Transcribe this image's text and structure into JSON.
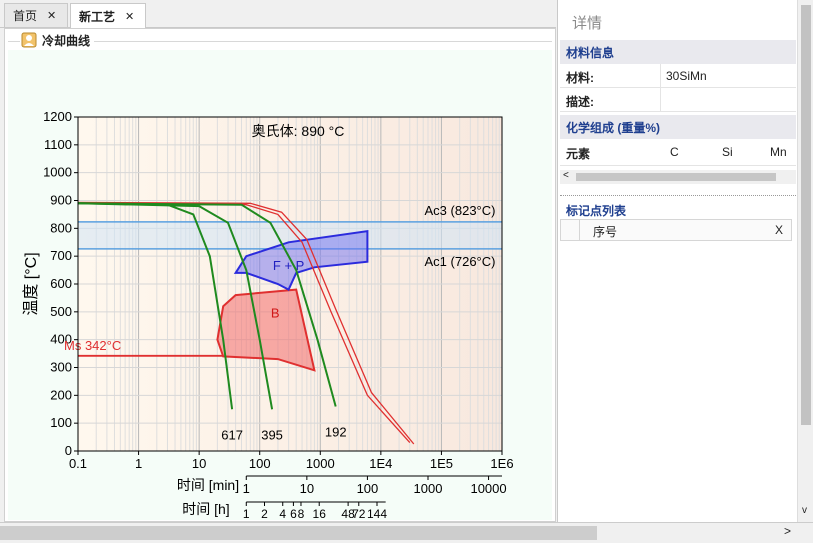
{
  "tabs": [
    {
      "label": "首页",
      "close": "✕"
    },
    {
      "label": "新工艺",
      "close": "✕"
    }
  ],
  "group": {
    "title": "冷却曲线"
  },
  "chart_data": {
    "type": "line",
    "title": "奥氏体: 890 °C",
    "ylabel": "温度 [°C]",
    "xlabel_min": "时间 [min]",
    "xlabel_h": "时间 [h]",
    "xscale": "log",
    "xlim": [
      0.1,
      1000000
    ],
    "ylim": [
      0,
      1200
    ],
    "yticks": [
      0,
      100,
      200,
      300,
      400,
      500,
      600,
      700,
      800,
      900,
      1000,
      1100,
      1200
    ],
    "yticklabels": [
      "0",
      "100",
      "200",
      "300",
      "400",
      "500",
      "600",
      "700",
      "800",
      "900",
      "1000",
      "1100",
      "1200"
    ],
    "xticks_min": [
      0.1,
      1,
      10,
      100,
      1000,
      10000,
      100000,
      1000000
    ],
    "xticklabels_min": [
      "0.1",
      "1",
      "10",
      "100",
      "1000",
      "1E4",
      "1E5",
      "1E6"
    ],
    "axis2_labels": [
      "1",
      "10",
      "100",
      "1000",
      "10000"
    ],
    "axis3_labels": [
      "1",
      "2",
      "4",
      "6",
      "8",
      "16",
      "48",
      "72",
      "144"
    ],
    "ac3": {
      "value": 823,
      "label": "Ac3 (823°C)"
    },
    "ac1": {
      "value": 726,
      "label": "Ac1 (726°C)"
    },
    "ms": {
      "value": 342,
      "label": "Ms 342°C"
    },
    "regions": [
      {
        "name": "F + P",
        "color": "#2020ff"
      },
      {
        "name": "B",
        "color": "#e02020"
      }
    ],
    "cooling_curves": [
      {
        "label": "617",
        "color": "#1f8a1f",
        "points": [
          [
            0.1,
            890
          ],
          [
            3,
            885
          ],
          [
            8,
            850
          ],
          [
            15,
            700
          ],
          [
            25,
            400
          ],
          [
            35,
            150
          ]
        ]
      },
      {
        "label": "395",
        "color": "#1f8a1f",
        "points": [
          [
            0.1,
            890
          ],
          [
            10,
            880
          ],
          [
            30,
            820
          ],
          [
            60,
            650
          ],
          [
            100,
            400
          ],
          [
            160,
            150
          ]
        ]
      },
      {
        "label": "192",
        "color": "#1f8a1f",
        "points": [
          [
            0.1,
            890
          ],
          [
            50,
            885
          ],
          [
            150,
            820
          ],
          [
            400,
            650
          ],
          [
            900,
            400
          ],
          [
            1800,
            160
          ]
        ]
      }
    ],
    "transformation_curves": [
      {
        "color": "#e03030",
        "points": [
          [
            0.1,
            890
          ],
          [
            60,
            885
          ],
          [
            200,
            850
          ],
          [
            500,
            750
          ],
          [
            1500,
            500
          ],
          [
            6000,
            200
          ],
          [
            30000,
            30
          ]
        ]
      },
      {
        "color": "#e03030",
        "points": [
          [
            0.1,
            893
          ],
          [
            70,
            890
          ],
          [
            230,
            858
          ],
          [
            600,
            760
          ],
          [
            1800,
            510
          ],
          [
            7000,
            210
          ],
          [
            35000,
            25
          ]
        ]
      }
    ],
    "fp_region": {
      "color": "#2b2bdd",
      "points": [
        [
          40,
          640
        ],
        [
          60,
          700
        ],
        [
          300,
          750
        ],
        [
          6000,
          790
        ],
        [
          6000,
          680
        ],
        [
          800,
          660
        ],
        [
          400,
          640
        ],
        [
          300,
          580
        ],
        [
          200,
          600
        ],
        [
          60,
          640
        ],
        [
          40,
          640
        ]
      ]
    },
    "b_region": {
      "color": "#e03030",
      "points": [
        [
          25,
          520
        ],
        [
          40,
          560
        ],
        [
          400,
          580
        ],
        [
          800,
          290
        ],
        [
          200,
          330
        ],
        [
          25,
          340
        ],
        [
          20,
          400
        ],
        [
          25,
          520
        ]
      ]
    }
  },
  "detail": {
    "title": "详情",
    "material_section": "材料信息",
    "material_label": "材料:",
    "material_value": "30SiMn",
    "desc_label": "描述:",
    "desc_value": "",
    "chem_section": "化学组成 (重量%)",
    "chem_headers": [
      "元素",
      "C",
      "Si",
      "Mn"
    ],
    "marker_section": "标记点列表",
    "marker_headers": [
      "序号",
      "X"
    ]
  },
  "colors": {
    "accent": "#1f3f8f",
    "green": "#1f8a1f",
    "red": "#e03030",
    "blue": "#2b2bdd",
    "band": "#cfe3f5"
  }
}
